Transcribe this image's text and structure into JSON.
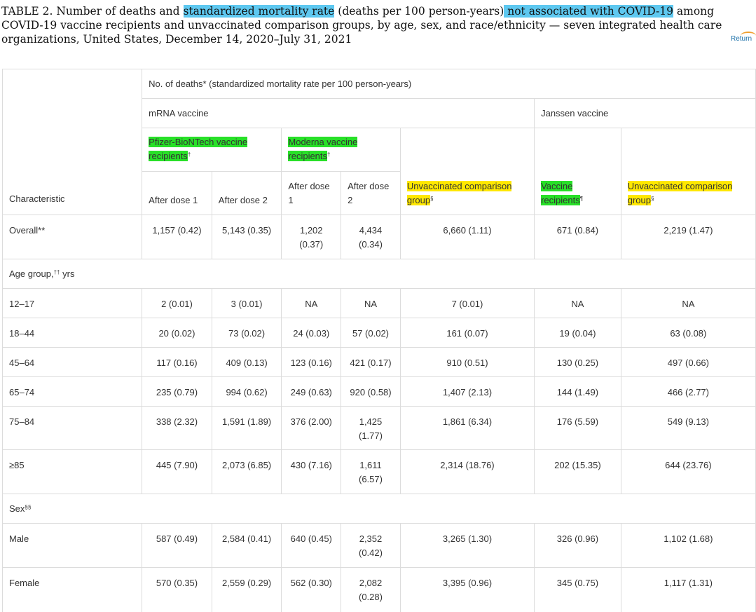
{
  "caption": {
    "part1": "TABLE 2. Number of deaths and ",
    "hl1": "standardized mortality rate",
    "part2": " (deaths per 100 person-years)",
    "hl2": " not associated with COVID-19",
    "part3": " among COVID-19 vaccine recipients and unvaccinated comparison groups, by age, sex, and race/ethnicity — seven integrated health care organizations, United States, December 14, 2020–July 31, 2021"
  },
  "return_label": "Return",
  "header": {
    "top": "No. of deaths* (standardized mortality rate per 100 person-years)",
    "mrna": "mRNA vaccine",
    "janssen": "Janssen vaccine",
    "pfizer": "Pfizer-BioNTech vaccine recipients",
    "pfizer_mark": "†",
    "moderna": "Moderna vaccine recipients",
    "moderna_mark": "†",
    "characteristic": "Characteristic",
    "after_dose1": "After dose 1",
    "after_dose2": "After dose 2",
    "mod_after_dose1": "After dose 1",
    "mod_after_dose2": "After dose 2",
    "unvax_mrna": "Unvaccinated comparison group",
    "unvax_mrna_mark": "§",
    "janssen_recip": "Vaccine recipients",
    "janssen_recip_mark": "¶",
    "unvax_janssen": "Unvaccinated comparison group",
    "unvax_janssen_mark": "§"
  },
  "sections": {
    "age": "Age group,",
    "age_mark": "††",
    "age_unit": " yrs",
    "sex": "Sex",
    "sex_mark": "§§"
  },
  "rows": {
    "overall": {
      "label": "Overall**",
      "c": [
        "1,157 (0.42)",
        "5,143 (0.35)",
        "1,202 (0.37)",
        "4,434 (0.34)",
        "6,660 (1.11)",
        "671 (0.84)",
        "2,219 (1.47)"
      ]
    },
    "a1": {
      "label": "12–17",
      "c": [
        "2 (0.01)",
        "3 (0.01)",
        "NA",
        "NA",
        "7 (0.01)",
        "NA",
        "NA"
      ]
    },
    "a2": {
      "label": "18–44",
      "c": [
        "20 (0.02)",
        "73 (0.02)",
        "24 (0.03)",
        "57 (0.02)",
        "161 (0.07)",
        "19 (0.04)",
        "63 (0.08)"
      ]
    },
    "a3": {
      "label": "45–64",
      "c": [
        "117 (0.16)",
        "409 (0.13)",
        "123 (0.16)",
        "421 (0.17)",
        "910 (0.51)",
        "130 (0.25)",
        "497 (0.66)"
      ]
    },
    "a4": {
      "label": "65–74",
      "c": [
        "235 (0.79)",
        "994 (0.62)",
        "249 (0.63)",
        "920 (0.58)",
        "1,407 (2.13)",
        "144 (1.49)",
        "466 (2.77)"
      ]
    },
    "a5": {
      "label": "75–84",
      "c": [
        "338 (2.32)",
        "1,591 (1.89)",
        "376 (2.00)",
        "1,425 (1.77)",
        "1,861 (6.34)",
        "176 (5.59)",
        "549 (9.13)"
      ]
    },
    "a6": {
      "label": "≥85",
      "c": [
        "445 (7.90)",
        "2,073 (6.85)",
        "430 (7.16)",
        "1,611 (6.57)",
        "2,314 (18.76)",
        "202 (15.35)",
        "644 (23.76)"
      ]
    },
    "male": {
      "label": "Male",
      "c": [
        "587 (0.49)",
        "2,584 (0.41)",
        "640 (0.45)",
        "2,352 (0.42)",
        "3,265 (1.30)",
        "326 (0.96)",
        "1,102 (1.68)"
      ]
    },
    "female": {
      "label": "Female",
      "c": [
        "570 (0.35)",
        "2,559 (0.29)",
        "562 (0.30)",
        "2,082 (0.28)",
        "3,395 (0.96)",
        "345 (0.75)",
        "1,117 (1.31)"
      ]
    }
  },
  "colors": {
    "highlight_blue": "#5ec8f0",
    "highlight_green": "#28e028",
    "highlight_yellow": "#ffe800"
  }
}
